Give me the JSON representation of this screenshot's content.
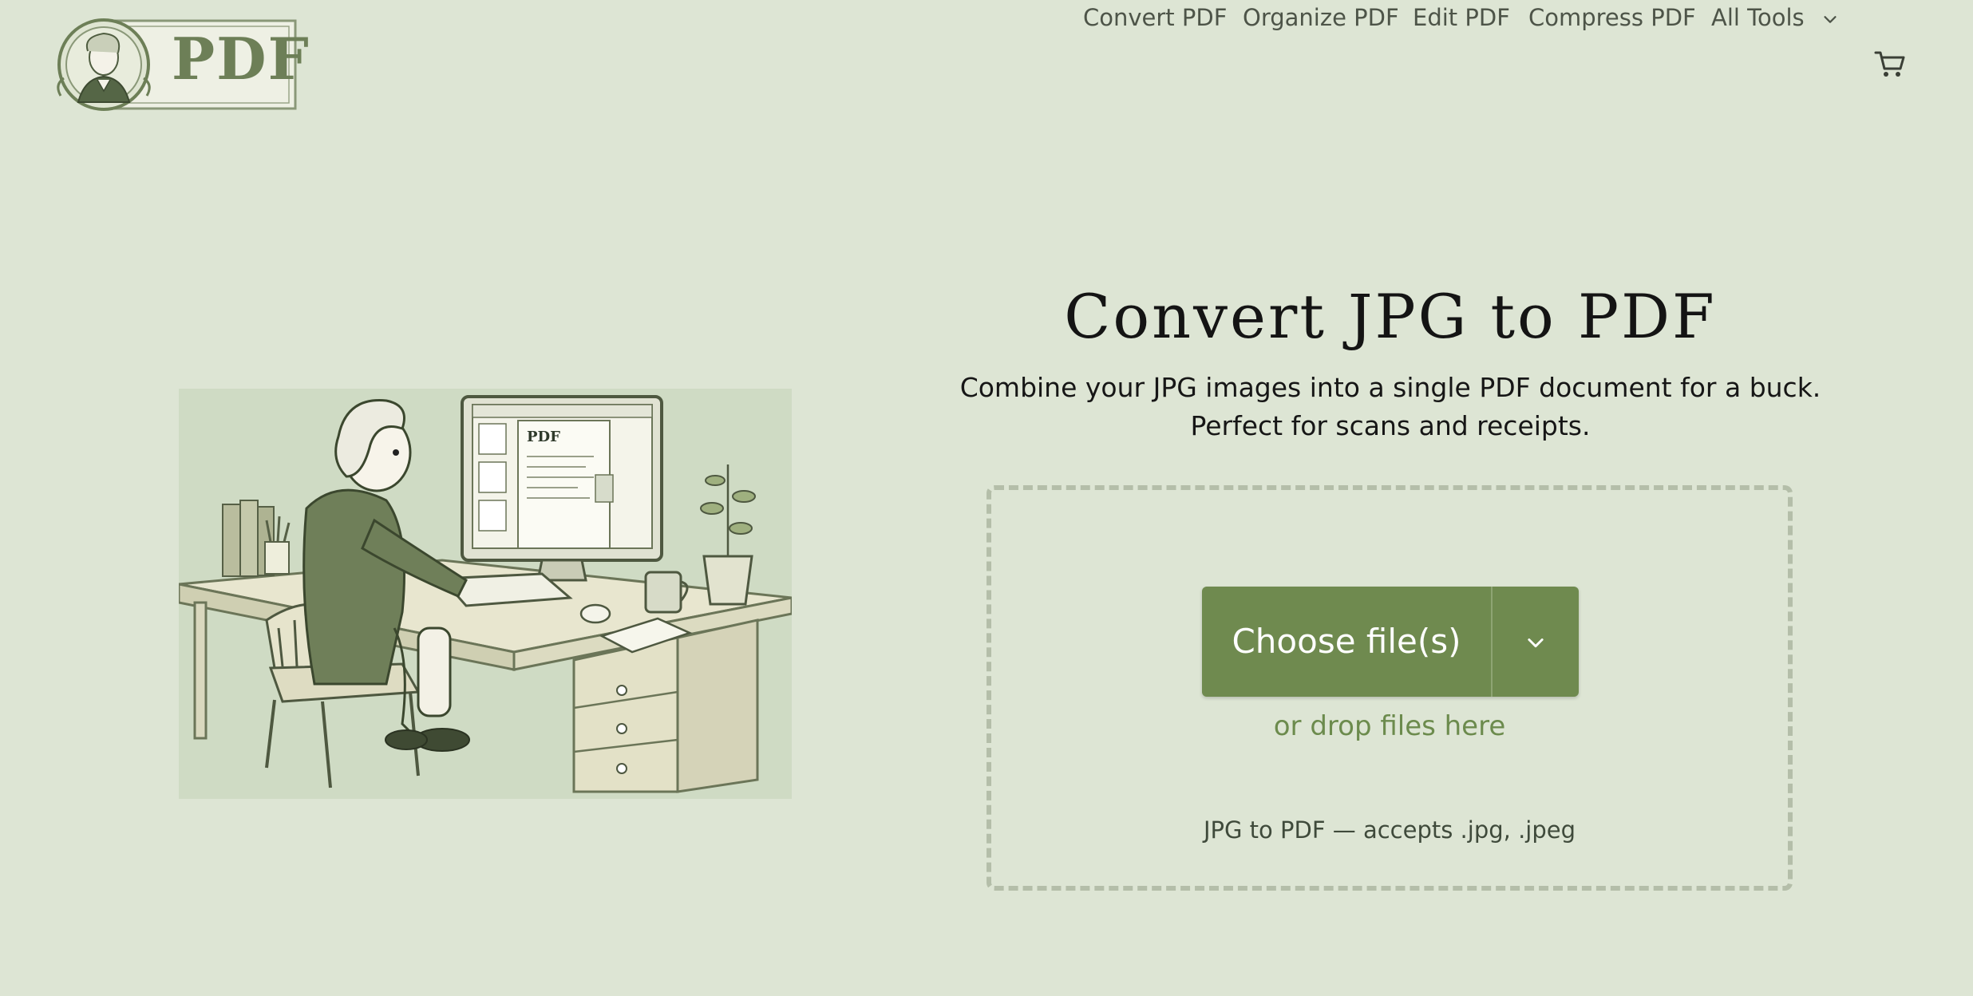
{
  "header": {
    "logo_text": "PDF",
    "nav": [
      {
        "label": "Convert PDF"
      },
      {
        "label": "Organize PDF"
      },
      {
        "label": "Edit PDF"
      },
      {
        "label": "Compress PDF"
      },
      {
        "label": "All Tools"
      }
    ],
    "cart_icon": "cart-icon"
  },
  "main": {
    "title": "Convert JPG to PDF",
    "subtitle_line1": "Combine your JPG images into a single PDF document for a buck.",
    "subtitle_line2": "Perfect for scans and receipts.",
    "choose_label": "Choose file(s)",
    "drop_hint": "or drop files here",
    "accepts": "JPG to PDF — accepts .jpg, .jpeg"
  },
  "illustration": {
    "screen_text": "PDF"
  },
  "colors": {
    "background": "#dde5d4",
    "accent": "#6f8a4f",
    "accent_text": "#6c8b4d",
    "border": "#b4bea9"
  }
}
